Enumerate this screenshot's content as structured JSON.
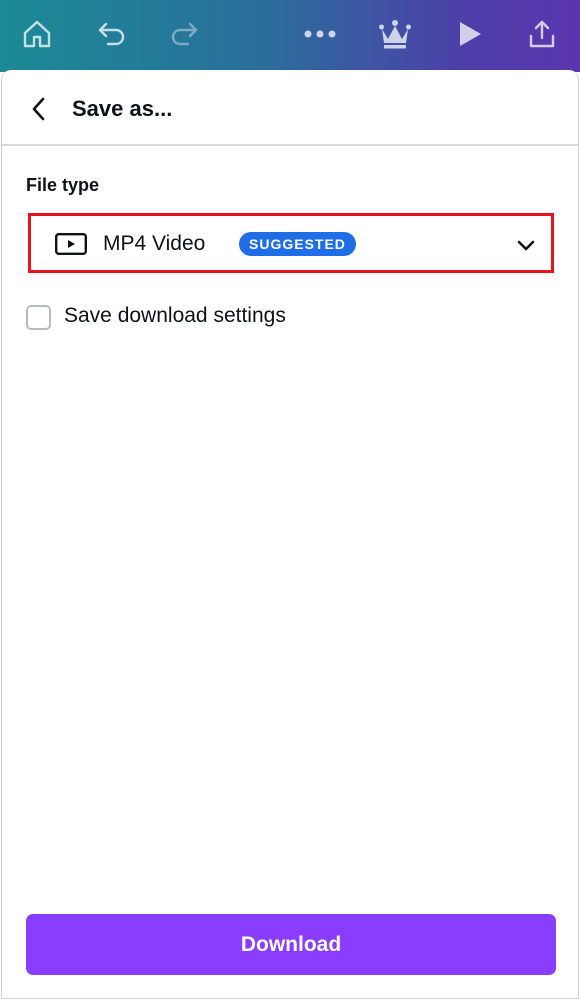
{
  "toolbar": {
    "icons": [
      "home-icon",
      "undo-icon",
      "redo-icon",
      "more-icon",
      "crown-icon",
      "play-icon",
      "share-icon"
    ]
  },
  "header": {
    "title": "Save as..."
  },
  "file_type": {
    "label": "File type",
    "selected": "MP4 Video",
    "badge": "SUGGESTED"
  },
  "save_settings": {
    "label": "Save download settings",
    "checked": false
  },
  "download": {
    "label": "Download"
  },
  "colors": {
    "accent_purple": "#8b3dff",
    "badge_blue": "#1f6ee7",
    "highlight_red": "#e8141b"
  }
}
